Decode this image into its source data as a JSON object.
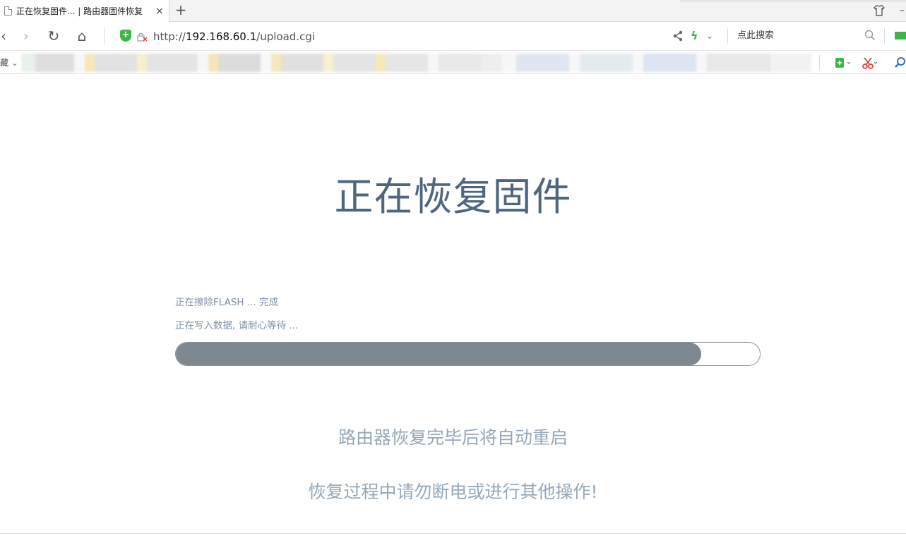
{
  "browser": {
    "tab": {
      "title": "正在恢复固件... | 路由器固件恢复",
      "close_glyph": "×"
    },
    "new_tab_glyph": "+",
    "skin_glyph": "👕",
    "minimize_glyph": "–",
    "nav": {
      "back_glyph": "‹",
      "forward_glyph": "›",
      "reload_glyph": "↻",
      "home_glyph": "⌂"
    },
    "address": {
      "scheme": "http://",
      "host": "192.168.60.1",
      "path": "/upload.cgi"
    },
    "search_placeholder": "点此搜索",
    "bookmarks_label": "藏",
    "bookmarks_chevron": "⌄",
    "share_glyph": "<",
    "bolt_glyph": "ϟ",
    "chevron_glyph": "⌄",
    "colors": {
      "shield": "#3cb54a",
      "tool_green": "#3cb54a",
      "tool_red": "#e0463a",
      "tool_blue": "#2a73d9"
    }
  },
  "page": {
    "title": "正在恢复固件",
    "status_lines": [
      "正在擦除FLASH ... 完成",
      "正在写入数据, 请耐心等待 ..."
    ],
    "progress_fraction": 0.9,
    "notes": [
      "路由器恢复完毕后将自动重启",
      "恢复过程中请勿断电或进行其他操作!"
    ],
    "colors": {
      "title": "#4f6680",
      "status_text": "#7d92a8",
      "progress_fill": "#7d8891",
      "note_text": "#95a8b9"
    }
  }
}
